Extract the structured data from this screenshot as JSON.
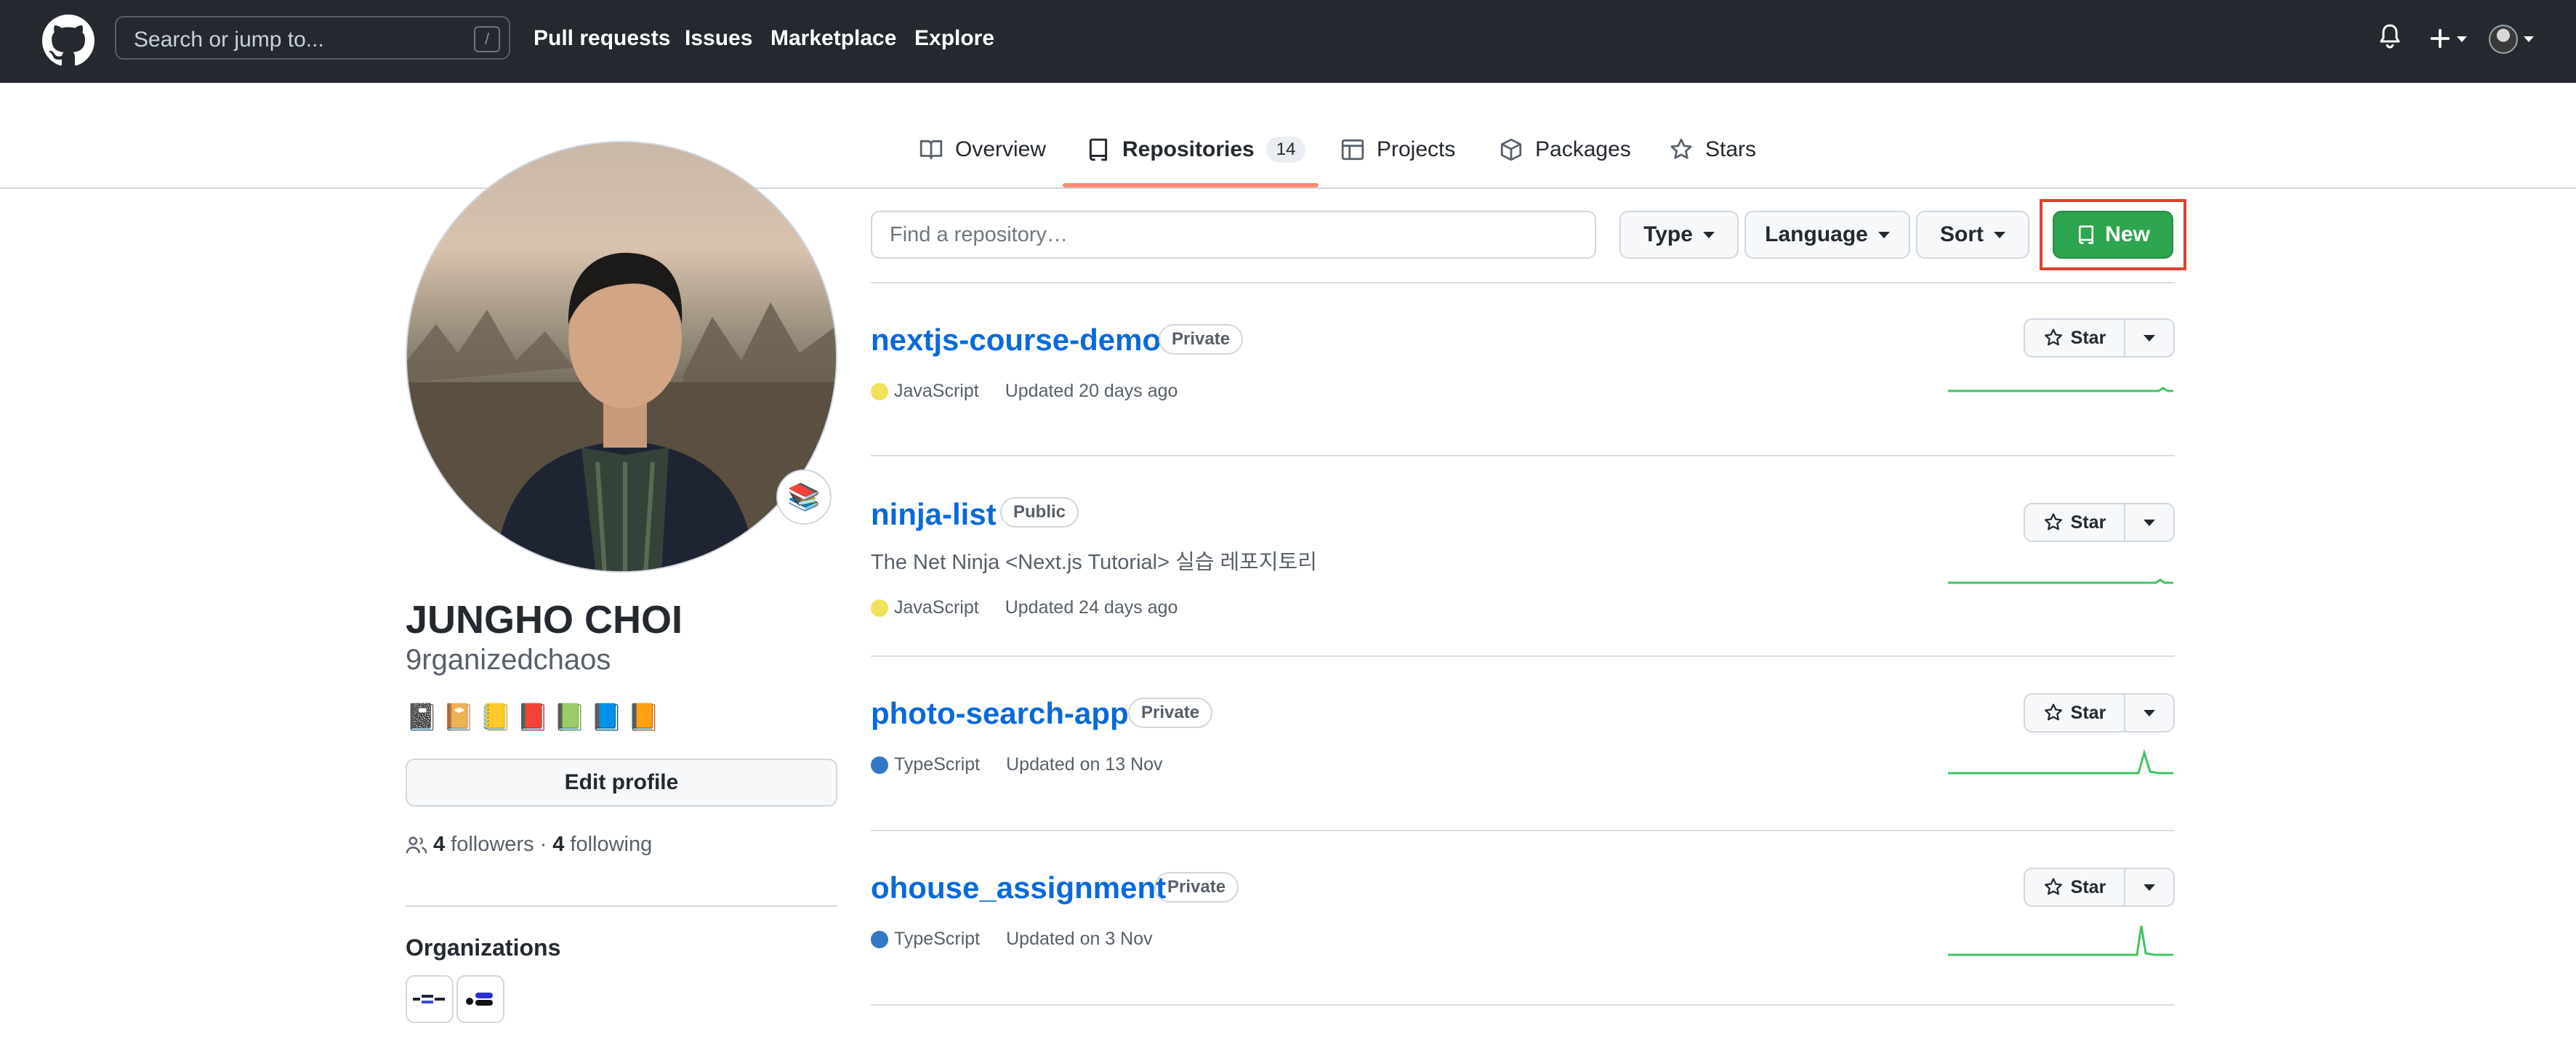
{
  "header": {
    "search_placeholder": "Search or jump to...",
    "search_shortcut": "/",
    "nav": [
      "Pull requests",
      "Issues",
      "Marketplace",
      "Explore"
    ]
  },
  "tabs": [
    {
      "label": "Overview",
      "icon": "book-icon"
    },
    {
      "label": "Repositories",
      "icon": "repo-icon",
      "count": "14",
      "active": true
    },
    {
      "label": "Projects",
      "icon": "table-icon"
    },
    {
      "label": "Packages",
      "icon": "package-icon"
    },
    {
      "label": "Stars",
      "icon": "star-icon"
    }
  ],
  "profile": {
    "full_name": "JUNGHO CHOI",
    "username": "9rganizedchaos",
    "status_emoji": "📚",
    "bio_emojis": "📓📔📒📕📗📘📙",
    "edit_label": "Edit profile",
    "followers_count": "4",
    "followers_label": "followers",
    "separator": "·",
    "following_count": "4",
    "following_label": "following",
    "orgs_title": "Organizations"
  },
  "toolbar": {
    "find_placeholder": "Find a repository…",
    "type_label": "Type",
    "language_label": "Language",
    "sort_label": "Sort",
    "new_label": "New"
  },
  "repos": [
    {
      "name": "nextjs-course-demo",
      "visibility": "Private",
      "description": "",
      "language": "JavaScript",
      "lang_color": "#f1e05a",
      "updated": "Updated 20 days ago",
      "star_label": "Star"
    },
    {
      "name": "ninja-list",
      "visibility": "Public",
      "description": "The Net Ninja <Next.js Tutorial> 실습 레포지토리",
      "language": "JavaScript",
      "lang_color": "#f1e05a",
      "updated": "Updated 24 days ago",
      "star_label": "Star"
    },
    {
      "name": "photo-search-app",
      "visibility": "Private",
      "description": "",
      "language": "TypeScript",
      "lang_color": "#3178c6",
      "updated": "Updated on 13 Nov",
      "star_label": "Star"
    },
    {
      "name": "ohouse_assignment",
      "visibility": "Private",
      "description": "",
      "language": "TypeScript",
      "lang_color": "#3178c6",
      "updated": "Updated on 3 Nov",
      "star_label": "Star"
    }
  ],
  "colors": {
    "header_bg": "#24292f",
    "accent_green": "#2da44e",
    "link_blue": "#0969da",
    "tab_underline": "#fd8c73",
    "highlight_red": "#e0412d"
  }
}
